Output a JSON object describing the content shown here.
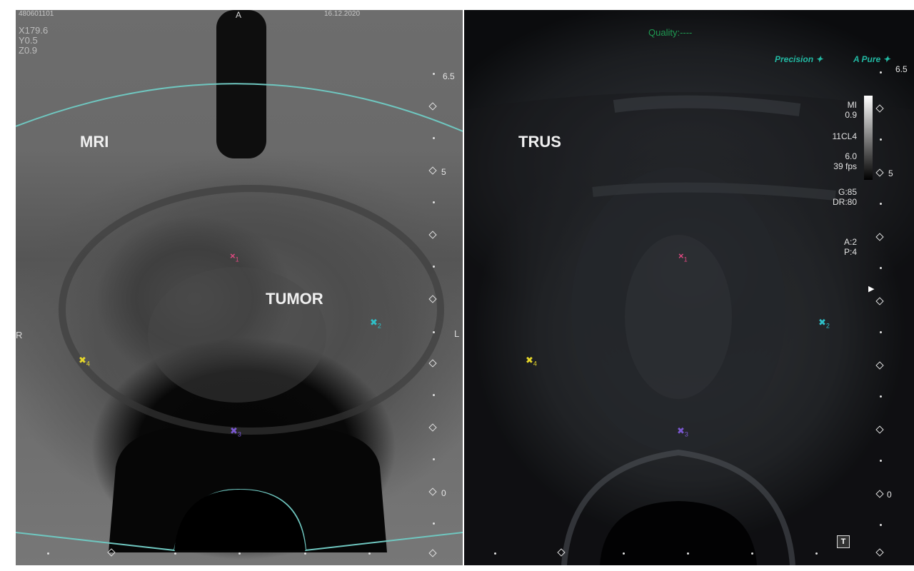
{
  "mri": {
    "id_text": "480601101",
    "sub_text": "",
    "coord_x": "X179.6",
    "coord_y": "Y0.5",
    "coord_z": "Z0.9",
    "orient_top": "A",
    "date": "16.12.2020",
    "label": "MRI",
    "tumor_label": "TUMOR",
    "side_left": "R",
    "side_right": "L",
    "scale_top": "6.5",
    "scale_mid": "5",
    "scale_bottom": "0"
  },
  "trus": {
    "quality": "Quality:----",
    "precision": "Precision",
    "apure": "A Pure",
    "scale_top": "6.5",
    "label": "TRUS",
    "mi_label": "MI",
    "mi_value": "0.9",
    "probe": "11CL4",
    "depth": "6.0",
    "fps": "39 fps",
    "scale_mid": "5",
    "gain": "G:85",
    "dr": "DR:80",
    "a": "A:2",
    "p": "P:4",
    "scale_bottom": "0",
    "t_button": "T"
  },
  "markers": {
    "m1": "1",
    "m2": "2",
    "m3": "3",
    "m4": "4"
  },
  "colors": {
    "marker1": "#e04a82",
    "marker2": "#2fc0c8",
    "marker3": "#7a58d0",
    "marker4": "#e6d72a",
    "contour": "#6fc7c0"
  }
}
